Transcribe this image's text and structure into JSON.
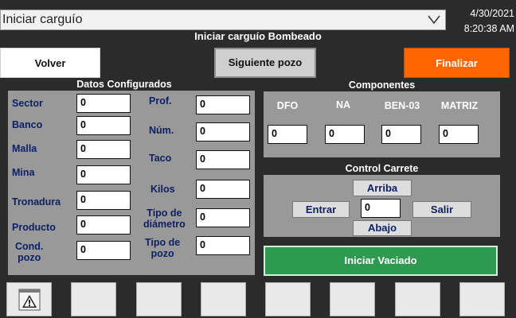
{
  "header": {
    "dropdown_value": "Iniciar carguío",
    "date": "4/30/2021",
    "time": "8:20:38 AM",
    "screen_title": "Iniciar carguío Bombeado"
  },
  "buttons": {
    "volver": "Volver",
    "siguiente": "Siguiente pozo",
    "finalizar": "Finalizar",
    "iniciar_vaciado": "Iniciar Vaciado"
  },
  "datos": {
    "title": "Datos Configurados",
    "left": [
      {
        "label": "Sector",
        "value": "0"
      },
      {
        "label": "Banco",
        "value": "0"
      },
      {
        "label": "Malla",
        "value": "0"
      },
      {
        "label": "Mina",
        "value": "0"
      },
      {
        "label": "Tronadura",
        "value": "0"
      },
      {
        "label": "Producto",
        "value": "0"
      },
      {
        "label": "Cond.",
        "label2": "pozo",
        "value": "0"
      }
    ],
    "right": [
      {
        "label": "Prof.",
        "value": "0"
      },
      {
        "label": "Núm.",
        "value": "0"
      },
      {
        "label": "Taco",
        "value": "0"
      },
      {
        "label": "Kilos",
        "value": "0"
      },
      {
        "label": "Tipo de",
        "label2": "diámetro",
        "value": "0"
      },
      {
        "label": "Tipo de",
        "label2": "pozo",
        "value": "0"
      }
    ]
  },
  "componentes": {
    "title": "Componentes",
    "items": [
      {
        "label": "DFO",
        "value": "0"
      },
      {
        "label": "NA",
        "value": "0"
      },
      {
        "label": "BEN-03",
        "value": "0"
      },
      {
        "label": "MATRIZ",
        "value": "0"
      }
    ]
  },
  "carrete": {
    "title": "Control Carrete",
    "arriba": "Arriba",
    "abajo": "Abajo",
    "entrar": "Entrar",
    "salir": "Salir",
    "value": "0"
  },
  "function_keys": [
    "warning-icon",
    "",
    "",
    "",
    "",
    "",
    "",
    ""
  ]
}
